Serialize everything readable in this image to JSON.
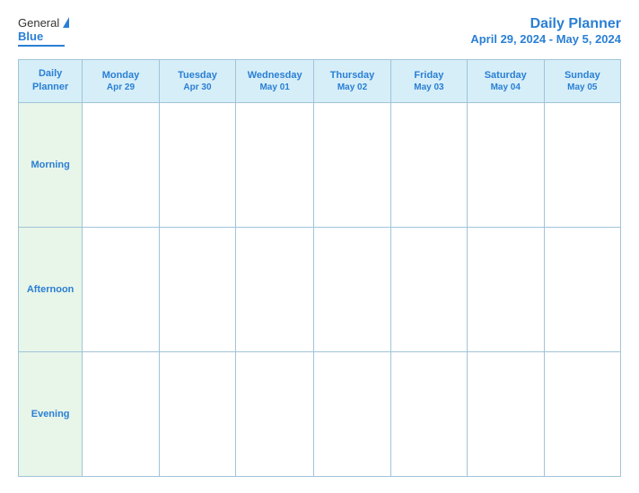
{
  "header": {
    "logo": {
      "general": "General",
      "blue": "Blue"
    },
    "title": "Daily Planner",
    "date_range": "April 29, 2024 - May 5, 2024"
  },
  "table": {
    "column_header": "Daily\nPlanner",
    "days": [
      {
        "name": "Monday",
        "date": "Apr 29"
      },
      {
        "name": "Tuesday",
        "date": "Apr 30"
      },
      {
        "name": "Wednesday",
        "date": "May 01"
      },
      {
        "name": "Thursday",
        "date": "May 02"
      },
      {
        "name": "Friday",
        "date": "May 03"
      },
      {
        "name": "Saturday",
        "date": "May 04"
      },
      {
        "name": "Sunday",
        "date": "May 05"
      }
    ],
    "rows": [
      {
        "label": "Morning"
      },
      {
        "label": "Afternoon"
      },
      {
        "label": "Evening"
      }
    ]
  }
}
